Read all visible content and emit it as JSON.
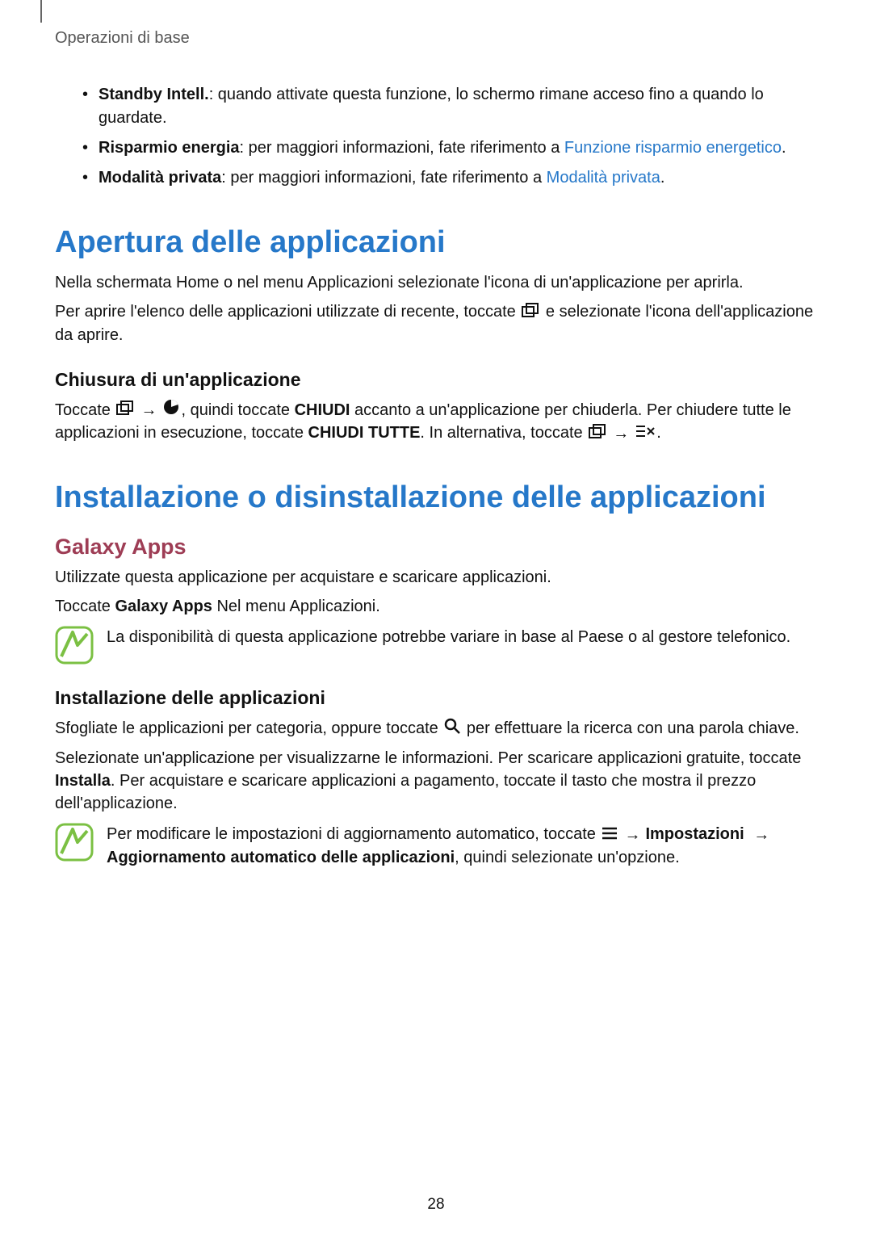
{
  "header": {
    "title": "Operazioni di base"
  },
  "bullets": [
    {
      "bold": "Standby Intell.",
      "text": ": quando attivate questa funzione, lo schermo rimane acceso fino a quando lo guardate."
    },
    {
      "bold": "Risparmio energia",
      "text": ": per maggiori informazioni, fate riferimento a ",
      "link": "Funzione risparmio energetico",
      "tail": "."
    },
    {
      "bold": "Modalità privata",
      "text": ": per maggiori informazioni, fate riferimento a ",
      "link": "Modalità privata",
      "tail": "."
    }
  ],
  "section1": {
    "title": "Apertura delle applicazioni",
    "p1": "Nella schermata Home o nel menu Applicazioni selezionate l'icona di un'applicazione per aprirla.",
    "p2a": "Per aprire l'elenco delle applicazioni utilizzate di recente, toccate ",
    "p2b": " e selezionate l'icona dell'applicazione da aprire.",
    "sub_title": "Chiusura di un'applicazione",
    "close": {
      "a": "Toccate ",
      "b": ", quindi toccate ",
      "chiudi": "CHIUDI",
      "c": " accanto a un'applicazione per chiuderla. Per chiudere tutte le applicazioni in esecuzione, toccate ",
      "chiudi_tutte": "CHIUDI TUTTE",
      "d": ". In alternativa, toccate ",
      "e": "."
    }
  },
  "section2": {
    "title": "Installazione o disinstallazione delle applicazioni",
    "galaxy_title": "Galaxy Apps",
    "p1": "Utilizzate questa applicazione per acquistare e scaricare applicazioni.",
    "p2a": "Toccate ",
    "p2_bold": "Galaxy Apps",
    "p2b": " Nel menu Applicazioni.",
    "note1": "La disponibilità di questa applicazione potrebbe variare in base al Paese o al gestore telefonico.",
    "install_title": "Installazione delle applicazioni",
    "install_p1a": "Sfogliate le applicazioni per categoria, oppure toccate ",
    "install_p1b": " per effettuare la ricerca con una parola chiave.",
    "install_p2a": "Selezionate un'applicazione per visualizzarne le informazioni. Per scaricare applicazioni gratuite, toccate ",
    "install_p2_bold": "Installa",
    "install_p2b": ". Per acquistare e scaricare applicazioni a pagamento, toccate il tasto che mostra il prezzo dell'applicazione.",
    "note2a": "Per modificare le impostazioni di aggiornamento automatico, toccate ",
    "note2_imp": "Impostazioni",
    "note2_agg": "Aggiornamento automatico delle applicazioni",
    "note2b": ", quindi selezionate un'opzione."
  },
  "arrow": "→",
  "page_number": "28"
}
